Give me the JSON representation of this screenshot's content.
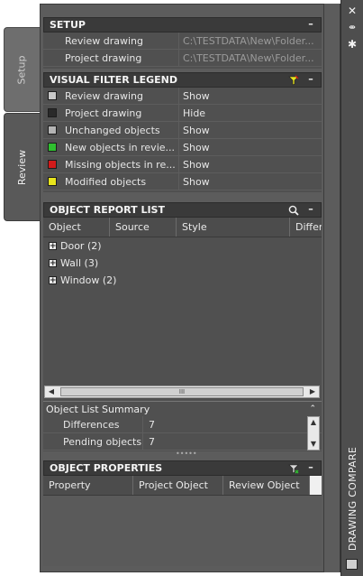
{
  "tabs": {
    "setup": "Setup",
    "review": "Review"
  },
  "right_bar": {
    "close_icon": "close-icon",
    "autohide_icon": "pin-icon",
    "properties_icon": "gear-icon",
    "title": "DRAWING COMPARE"
  },
  "setup": {
    "title": "SETUP",
    "collapse": "–",
    "rows": [
      {
        "label": "Review drawing",
        "value": "C:\\TESTDATA\\New\\Folder..."
      },
      {
        "label": "Project drawing",
        "value": "C:\\TESTDATA\\New\\Folder..."
      }
    ]
  },
  "legend": {
    "title": "VISUAL FILTER LEGEND",
    "collapse": "–",
    "rows": [
      {
        "label": "Review drawing",
        "value": "Show",
        "color": "#c8c8c8"
      },
      {
        "label": "Project drawing",
        "value": "Hide",
        "color": "#2a2a2a"
      },
      {
        "label": "Unchanged objects",
        "value": "Show",
        "color": "#b4b4b4"
      },
      {
        "label": "New objects in revie...",
        "value": "Show",
        "color": "#2fbf2f"
      },
      {
        "label": "Missing objects in re...",
        "value": "Show",
        "color": "#d21a1a"
      },
      {
        "label": "Modified objects",
        "value": "Show",
        "color": "#e8e41c"
      }
    ]
  },
  "report": {
    "title": "OBJECT REPORT LIST",
    "collapse": "–",
    "columns": [
      "Object",
      "Source",
      "Style",
      "Differ"
    ],
    "items": [
      {
        "label": "Door (2)"
      },
      {
        "label": "Wall (3)"
      },
      {
        "label": "Window (2)"
      }
    ],
    "scroll_thumb": "III",
    "summary": {
      "title": "Object List Summary",
      "rows": [
        {
          "label": "Differences",
          "value": "7"
        },
        {
          "label": "Pending objects",
          "value": "7"
        }
      ]
    }
  },
  "properties": {
    "title": "OBJECT PROPERTIES",
    "collapse": "–",
    "columns": [
      "Property",
      "Project Object",
      "Review Object"
    ]
  }
}
